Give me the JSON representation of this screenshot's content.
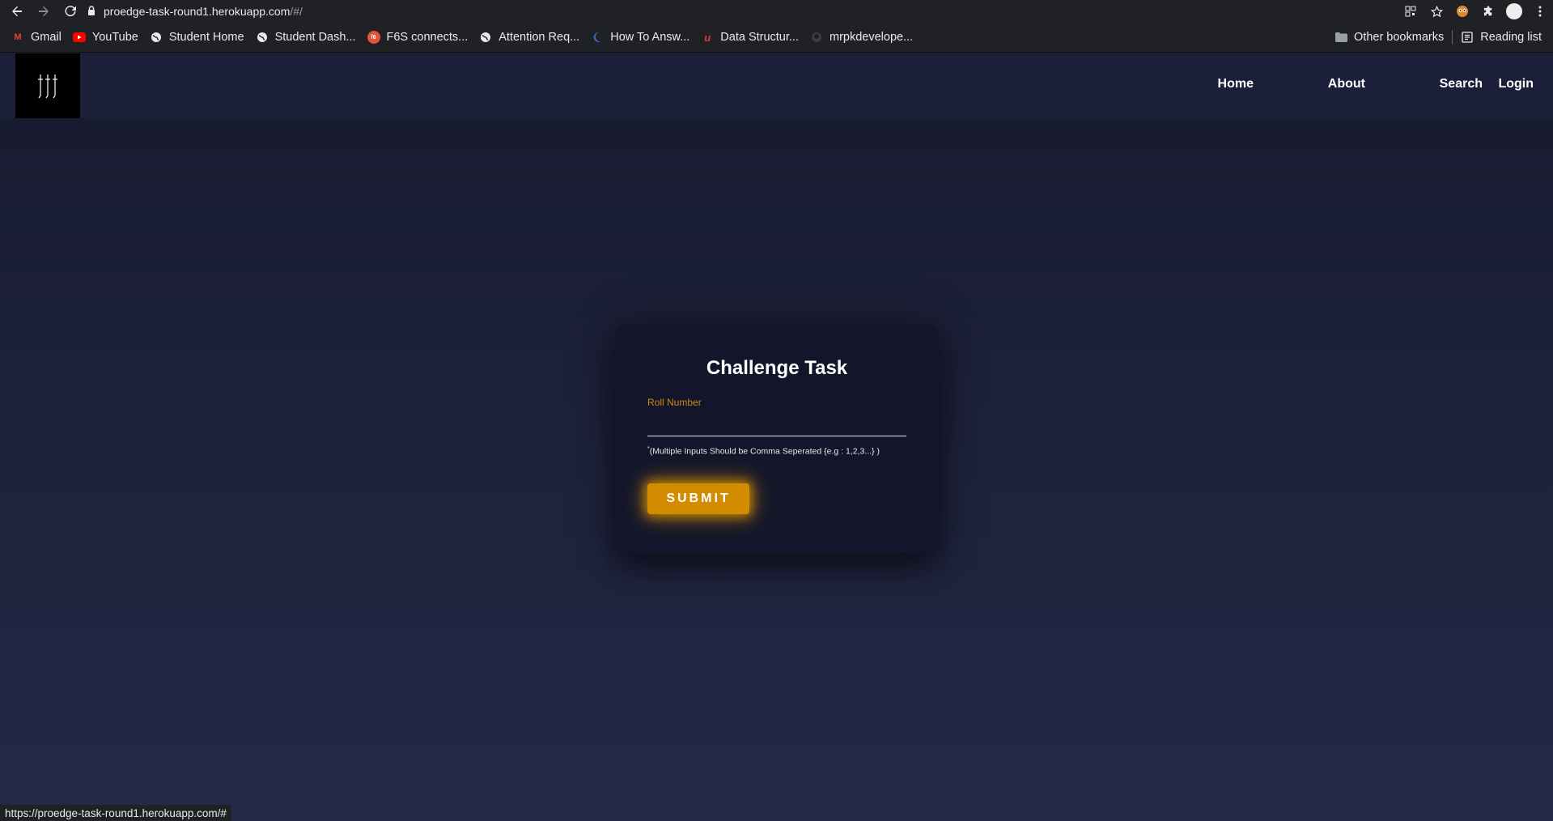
{
  "browser": {
    "url_host": "proedge-task-round1.herokuapp.com",
    "url_path": "/#/",
    "bookmarks": [
      {
        "label": "Gmail",
        "icon": "gmail-icon"
      },
      {
        "label": "YouTube",
        "icon": "youtube-icon"
      },
      {
        "label": "Student Home",
        "icon": "globe-icon"
      },
      {
        "label": "Student Dash...",
        "icon": "globe-icon"
      },
      {
        "label": "F6S connects...",
        "icon": "f6s-icon"
      },
      {
        "label": "Attention Req...",
        "icon": "globe-icon"
      },
      {
        "label": "How To Answ...",
        "icon": "moon-icon"
      },
      {
        "label": "Data Structur...",
        "icon": "brand-icon"
      },
      {
        "label": "mrpkdevelope...",
        "icon": "github-icon"
      }
    ],
    "other_bookmarks": "Other bookmarks",
    "reading_list": "Reading list",
    "status_url": "https://proedge-task-round1.herokuapp.com/#"
  },
  "site": {
    "nav": [
      "Home",
      "About",
      "Search",
      "Login"
    ]
  },
  "form": {
    "title": "Challenge Task",
    "field_label": "Roll Number",
    "field_value": "",
    "hint_mark": "*",
    "hint": "(Multiple Inputs Should be Comma Seperated {e.g : 1,2,3...} )",
    "submit_label": "SUBMIT"
  },
  "colors": {
    "accent": "#d38c00",
    "label": "#c98a14",
    "card_bg": "#13162a",
    "header_bg": "#1c1f3a"
  }
}
